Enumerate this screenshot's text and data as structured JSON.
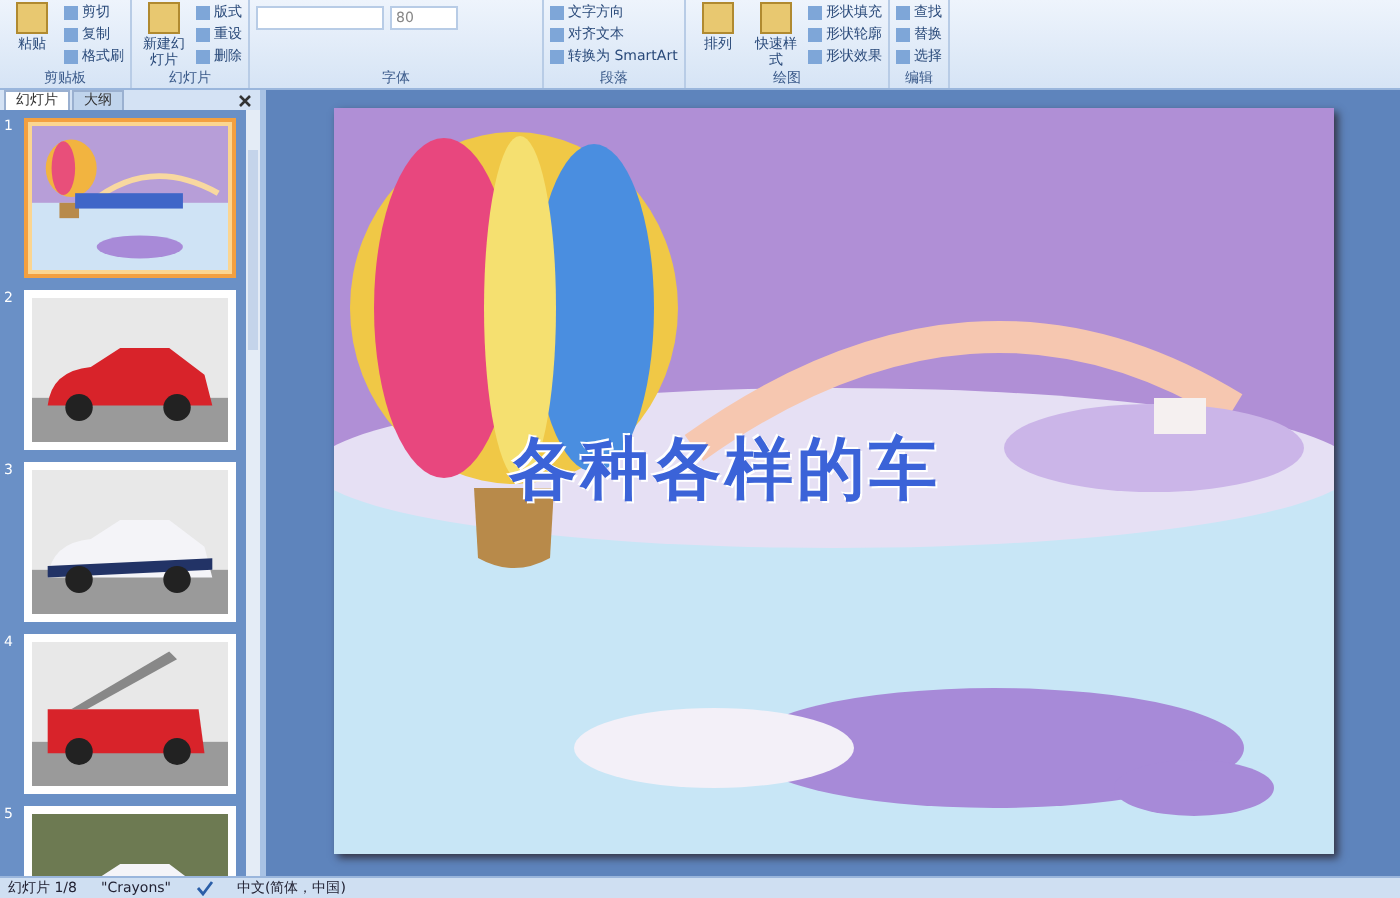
{
  "ribbon": {
    "groups": [
      {
        "label": "剪贴板",
        "large": [
          {
            "label": "粘贴"
          }
        ],
        "small": [
          {
            "label": "剪切"
          },
          {
            "label": "复制"
          },
          {
            "label": "格式刷"
          }
        ]
      },
      {
        "label": "幻灯片",
        "large": [
          {
            "label": "新建幻灯片"
          }
        ],
        "small": [
          {
            "label": "版式"
          },
          {
            "label": "重设"
          },
          {
            "label": "删除"
          }
        ]
      },
      {
        "label": "字体",
        "font_size": "80"
      },
      {
        "label": "段落",
        "small": [
          {
            "label": "文字方向"
          },
          {
            "label": "对齐文本"
          },
          {
            "label": "转换为 SmartArt"
          }
        ]
      },
      {
        "label": "绘图",
        "large": [
          {
            "label": "排列"
          },
          {
            "label": "快速样式"
          }
        ],
        "small": [
          {
            "label": "形状填充"
          },
          {
            "label": "形状轮廓"
          },
          {
            "label": "形状效果"
          }
        ]
      },
      {
        "label": "编辑",
        "small": [
          {
            "label": "查找"
          },
          {
            "label": "替换"
          },
          {
            "label": "选择"
          }
        ]
      }
    ]
  },
  "pane_tabs": [
    {
      "label": "幻灯片",
      "selected": true
    },
    {
      "label": "大纲",
      "selected": false
    }
  ],
  "slides": [
    {
      "number": "1",
      "selected": true
    },
    {
      "number": "2",
      "selected": false
    },
    {
      "number": "3",
      "selected": false
    },
    {
      "number": "4",
      "selected": false
    },
    {
      "number": "5",
      "selected": false
    }
  ],
  "slide": {
    "title": "各种各样的车"
  },
  "status_bar": {
    "slide": "幻灯片 1/8",
    "theme": "\"Crayons\"",
    "language": "中文(简体，中国)"
  }
}
